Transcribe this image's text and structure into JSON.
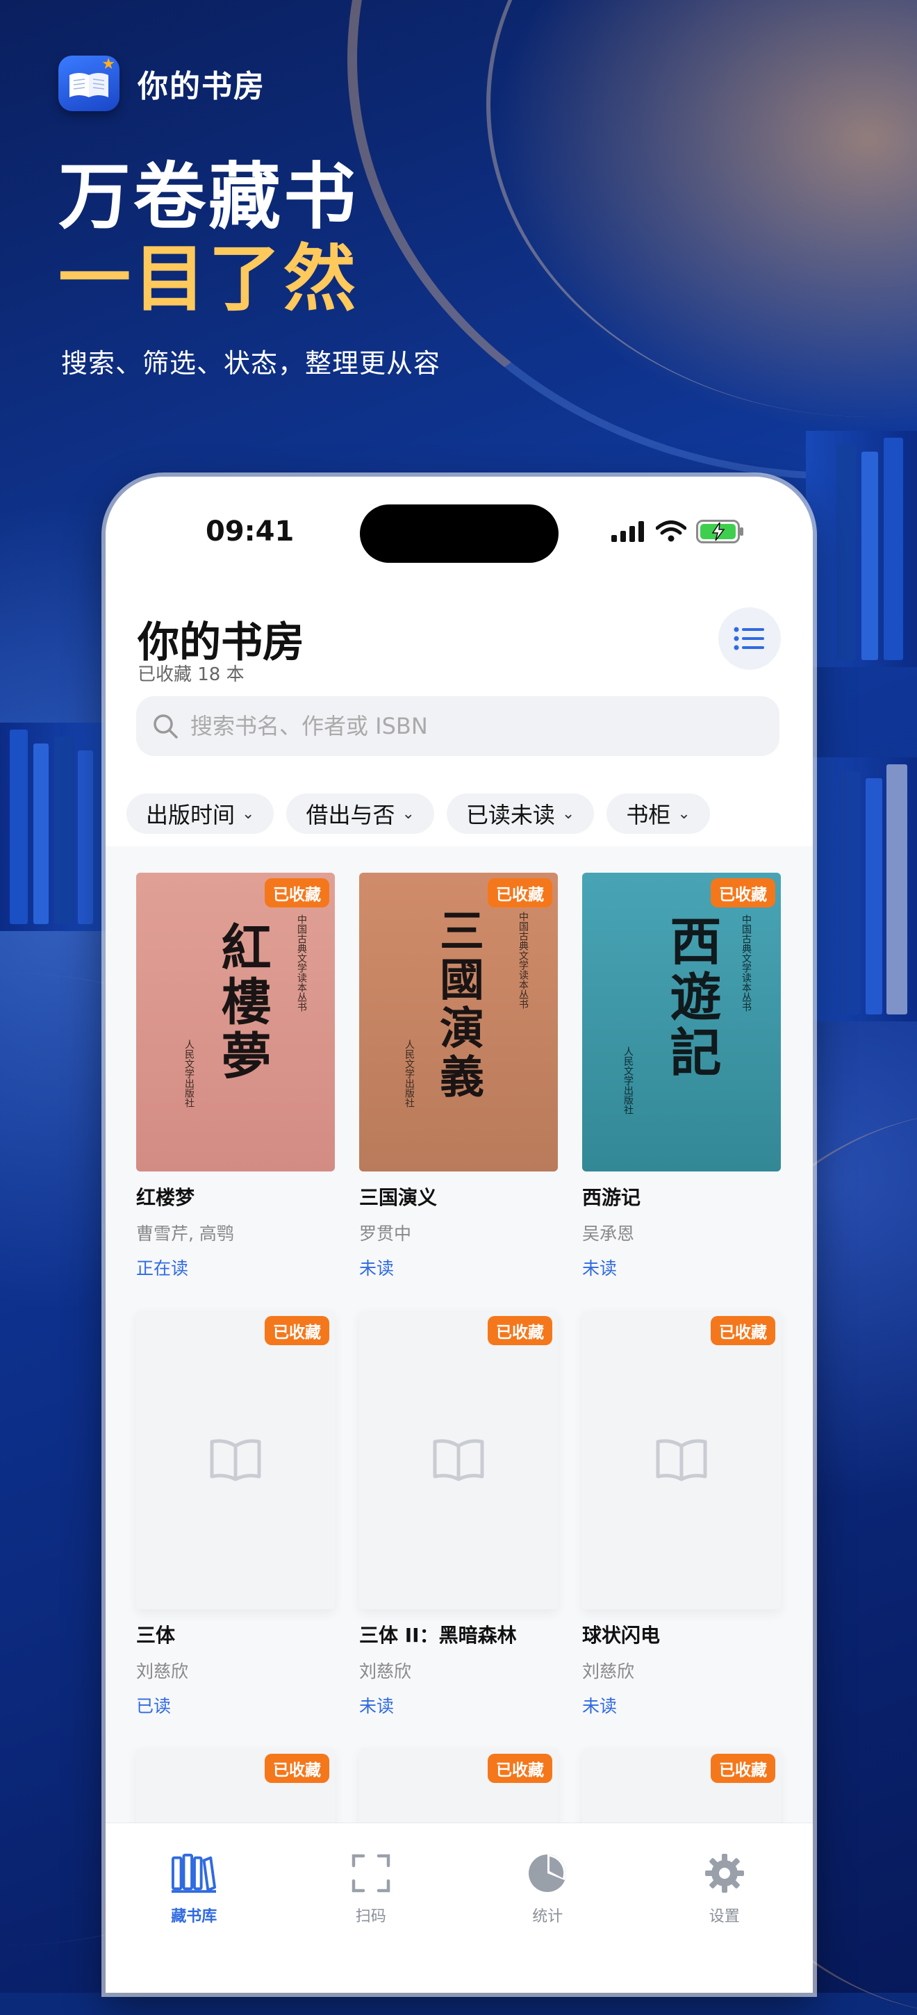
{
  "header": {
    "brand_name": "你的书房",
    "hero_line1": "万卷藏书",
    "hero_line2": "一目了然",
    "hero_sub": "搜索、筛选、状态，整理更从容"
  },
  "status_bar": {
    "time": "09:41"
  },
  "library": {
    "title": "你的书房",
    "count_text": "已收藏 18 本",
    "search_placeholder": "搜索书名、作者或 ISBN",
    "filters": [
      {
        "label": "出版时间"
      },
      {
        "label": "借出与否"
      },
      {
        "label": "已读未读"
      },
      {
        "label": "书柜"
      }
    ],
    "badge_label": "已收藏",
    "books": [
      {
        "title": "红楼梦",
        "author": "曹雪芹, 高鹗",
        "status": "正在读",
        "cover_title": "紅樓夢",
        "cover_series": "中国古典文学读本丛书",
        "cover_publisher": "人民文学出版社",
        "cover_color": "#d9948a"
      },
      {
        "title": "三国演义",
        "author": "罗贯中",
        "status": "未读",
        "cover_title": "三國演義",
        "cover_series": "中国古典文学读本丛书",
        "cover_publisher": "人民文学出版社",
        "cover_color": "#c98863"
      },
      {
        "title": "西游记",
        "author": "吴承恩",
        "status": "未读",
        "cover_title": "西遊記",
        "cover_series": "中国古典文学读本丛书",
        "cover_publisher": "人民文学出版社",
        "cover_color": "#3c97a8"
      },
      {
        "title": "三体",
        "author": "刘慈欣",
        "status": "已读"
      },
      {
        "title": "三体 II：黑暗森林",
        "author": "刘慈欣",
        "status": "未读"
      },
      {
        "title": "球状闪电",
        "author": "刘慈欣",
        "status": "未读"
      }
    ]
  },
  "tabbar": {
    "items": [
      {
        "label": "藏书库",
        "icon": "bookshelf-icon",
        "active": true
      },
      {
        "label": "扫码",
        "icon": "scan-icon",
        "active": false
      },
      {
        "label": "统计",
        "icon": "pie-chart-icon",
        "active": false
      },
      {
        "label": "设置",
        "icon": "gear-icon",
        "active": false
      }
    ]
  },
  "colors": {
    "accent": "#2f6ae0",
    "badge": "#f5771b",
    "hero_highlight": "#ffc95c"
  }
}
